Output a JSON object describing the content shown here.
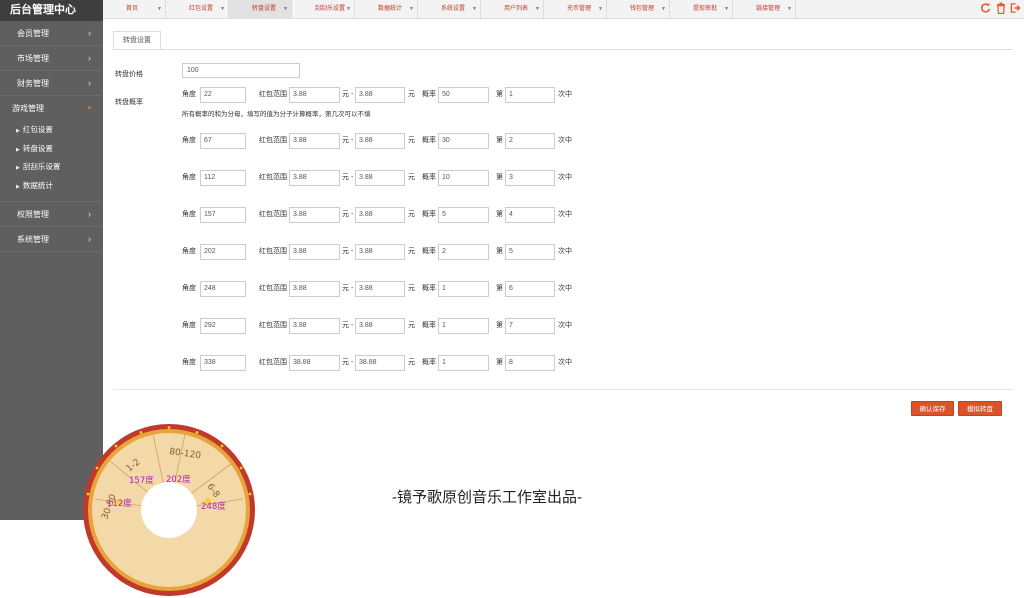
{
  "sidebar": {
    "brand": "后台管理中心",
    "items": [
      {
        "label": "会员管理"
      },
      {
        "label": "市场管理"
      },
      {
        "label": "财务管理"
      },
      {
        "label": "游戏管理"
      },
      {
        "label": "权限管理"
      },
      {
        "label": "系统管理"
      }
    ],
    "sub_items": [
      {
        "label": "红包设置"
      },
      {
        "label": "转盘设置"
      },
      {
        "label": "刮刮乐设置"
      },
      {
        "label": "数据统计"
      }
    ]
  },
  "topbar": {
    "tabs": [
      {
        "label": "首页"
      },
      {
        "label": "红包设置"
      },
      {
        "label": "转盘设置"
      },
      {
        "label": "刮刮乐设置"
      },
      {
        "label": "数据统计"
      },
      {
        "label": "系统设置"
      },
      {
        "label": "用户列表"
      },
      {
        "label": "充币管理"
      },
      {
        "label": "钱包管理"
      },
      {
        "label": "提现审批"
      },
      {
        "label": "链接管理"
      }
    ],
    "icons": [
      "refresh-icon",
      "trash-icon",
      "logout-icon"
    ],
    "accent": "#e05a2a"
  },
  "panel": {
    "tab": "转盘设置",
    "price_label": "转盘价格",
    "price_value": "100",
    "prob_label": "转盘概率",
    "hint": "所有概率的和为分母，填写的值为分子计算概率，第几次可以不填",
    "text_angle": "角度",
    "text_range": "红包范围",
    "text_yuan_dash": "元 -",
    "text_yuan": "元",
    "text_prob": "概率",
    "text_di": "第",
    "text_times": "次中",
    "rows": [
      {
        "angle": "22",
        "min": "3.88",
        "max": "3.88",
        "prob": "50",
        "nth": "1"
      },
      {
        "angle": "67",
        "min": "3.88",
        "max": "3.88",
        "prob": "30",
        "nth": "2"
      },
      {
        "angle": "112",
        "min": "3.88",
        "max": "3.88",
        "prob": "10",
        "nth": "3"
      },
      {
        "angle": "157",
        "min": "3.88",
        "max": "3.88",
        "prob": "5",
        "nth": "4"
      },
      {
        "angle": "202",
        "min": "3.88",
        "max": "3.88",
        "prob": "2",
        "nth": "5"
      },
      {
        "angle": "248",
        "min": "3.88",
        "max": "3.88",
        "prob": "1",
        "nth": "6"
      },
      {
        "angle": "292",
        "min": "3.88",
        "max": "3.88",
        "prob": "1",
        "nth": "7"
      },
      {
        "angle": "338",
        "min": "38.88",
        "max": "38.88",
        "prob": "1",
        "nth": "8"
      }
    ],
    "confirm_button": "确认保存",
    "simulate_button": "模拟转盘",
    "button_color": "#d9532b"
  },
  "wheel": {
    "outer_labels": [
      "30-50",
      "1-2",
      "80-120",
      "6-8"
    ],
    "inner_labels": [
      "112度",
      "157度",
      "202度",
      "248度"
    ]
  },
  "watermark": "-镜予歌原创音乐工作室出品-"
}
